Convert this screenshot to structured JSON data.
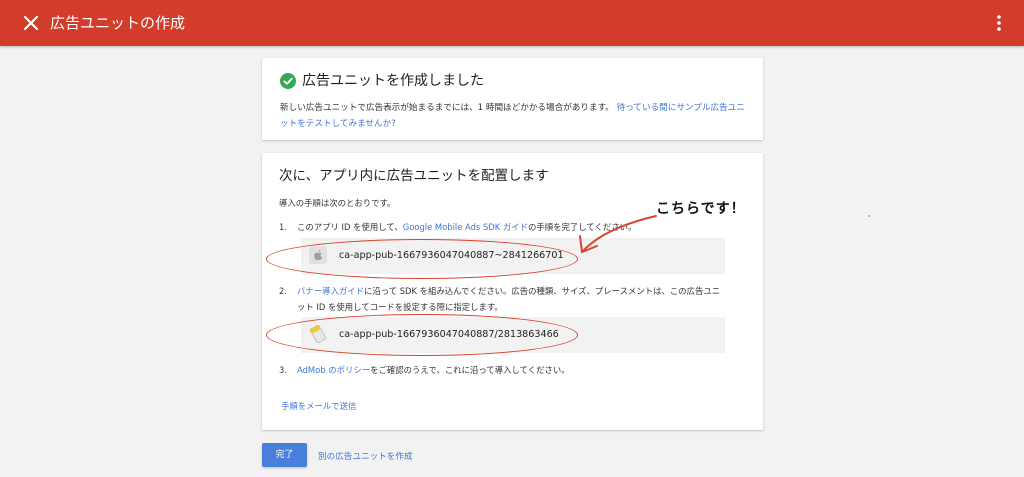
{
  "header": {
    "title": "広告ユニットの作成"
  },
  "success_card": {
    "title": "広告ユニットを作成しました",
    "description": "新しい広告ユニットで広告表示が始まるまでには、1 時間ほどかかる場合があります。",
    "test_link": "待っている間にサンプル広告ユニットをテストしてみませんか?"
  },
  "placement_card": {
    "title": "次に、アプリ内に広告ユニットを配置します",
    "intro": "導入の手順は次のとおりです。",
    "step1": {
      "number": "1.",
      "text_before": "このアプリ ID を使用して、",
      "link": "Google Mobile Ads SDK ガイド",
      "text_after": "の手順を完了してください。",
      "app_id": "ca-app-pub-1667936047040887~2841266701",
      "icon": "apple-icon"
    },
    "step2": {
      "number": "2.",
      "link": "バナー導入ガイド",
      "text_after": "に沿って SDK を組み込んでください。広告の種類、サイズ、プレースメントは、この広告ユニット ID を使用してコードを設定する際に指定します。",
      "ad_unit_id": "ca-app-pub-1667936047040887/2813863466",
      "icon": "ad-unit-icon"
    },
    "step3": {
      "number": "3.",
      "link": "AdMob のポリシー",
      "text_after": "をご確認のうえで、これに沿って導入してください。"
    },
    "email_link": "手順をメールで送信"
  },
  "footer": {
    "done_button": "完了",
    "another_link": "別の広告ユニットを作成"
  },
  "annotation": {
    "text": "こちらです！"
  },
  "colors": {
    "header": "#d23c2b",
    "accent": "#4a7fdc",
    "link": "#3f76d6",
    "success": "#34a853",
    "annotation": "#d9432f"
  }
}
